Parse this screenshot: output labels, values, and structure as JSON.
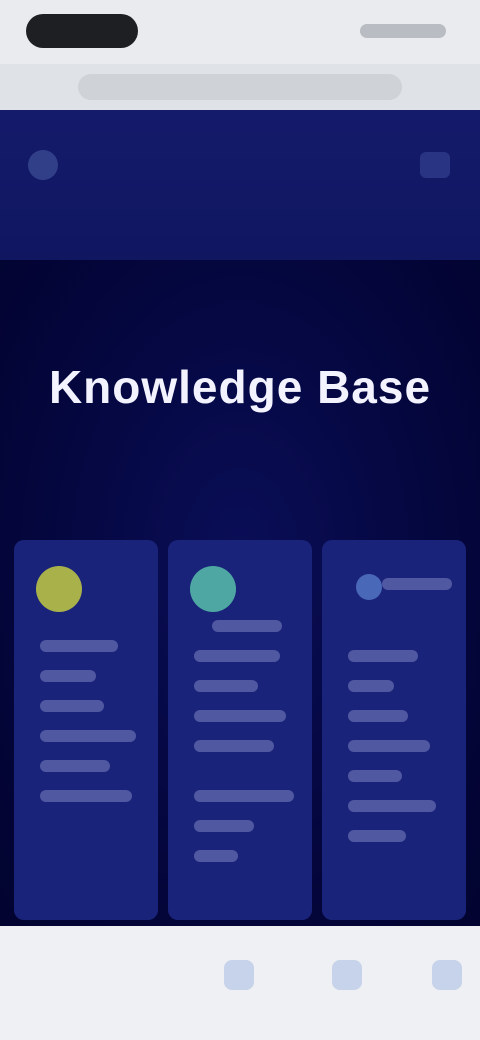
{
  "browser": {
    "status_icons": "status-icons",
    "url": ""
  },
  "site": {
    "nav_left_icon": "logo-icon",
    "nav_right_icon": "menu-icon"
  },
  "hero": {
    "title": "Knowledge Base",
    "subtitle": ""
  },
  "cards": [
    {
      "icon": "yellow-circle-icon",
      "tag": ""
    },
    {
      "icon": "teal-circle-icon",
      "tag": ""
    },
    {
      "icon": "blue-badge-icon",
      "tag": ""
    }
  ],
  "colors": {
    "hero_bg": "#03043a",
    "header_bg": "#141b6a",
    "card_bg": "#1a237a",
    "accent_yellow": "#a9b24a",
    "accent_teal": "#4ea7a2",
    "accent_blue": "#4a68b8"
  }
}
